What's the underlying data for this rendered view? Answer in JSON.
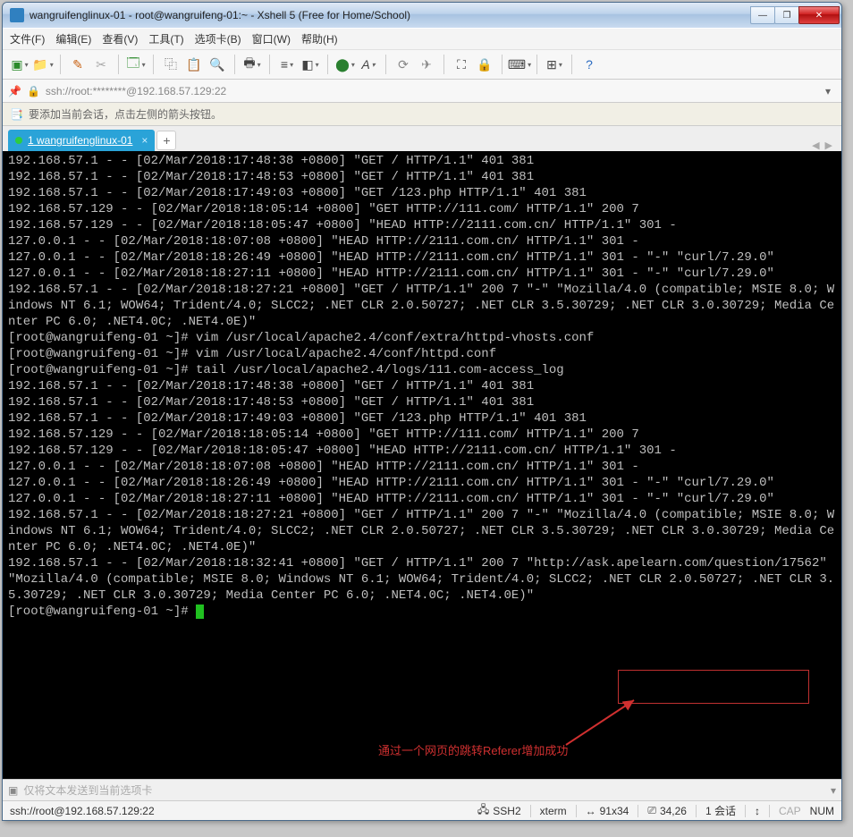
{
  "window": {
    "title": "wangruifenglinux-01 - root@wangruifeng-01:~ - Xshell 5 (Free for Home/School)"
  },
  "menu": {
    "file": "文件(F)",
    "edit": "编辑(E)",
    "view": "查看(V)",
    "tools": "工具(T)",
    "tab": "选项卡(B)",
    "window": "窗口(W)",
    "help": "帮助(H)"
  },
  "address": {
    "url": "ssh://root:********@192.168.57.129:22"
  },
  "infobar": {
    "text": "要添加当前会话，点击左侧的箭头按钮。"
  },
  "tab": {
    "label": "1 wangruifenglinux-01"
  },
  "terminal": {
    "lines": [
      "192.168.57.1 - - [02/Mar/2018:17:48:38 +0800] \"GET / HTTP/1.1\" 401 381",
      "192.168.57.1 - - [02/Mar/2018:17:48:53 +0800] \"GET / HTTP/1.1\" 401 381",
      "192.168.57.1 - - [02/Mar/2018:17:49:03 +0800] \"GET /123.php HTTP/1.1\" 401 381",
      "192.168.57.129 - - [02/Mar/2018:18:05:14 +0800] \"GET HTTP://111.com/ HTTP/1.1\" 200 7",
      "192.168.57.129 - - [02/Mar/2018:18:05:47 +0800] \"HEAD HTTP://2111.com.cn/ HTTP/1.1\" 301 -",
      "127.0.0.1 - - [02/Mar/2018:18:07:08 +0800] \"HEAD HTTP://2111.com.cn/ HTTP/1.1\" 301 -",
      "127.0.0.1 - - [02/Mar/2018:18:26:49 +0800] \"HEAD HTTP://2111.com.cn/ HTTP/1.1\" 301 - \"-\" \"curl/7.29.0\"",
      "127.0.0.1 - - [02/Mar/2018:18:27:11 +0800] \"HEAD HTTP://2111.com.cn/ HTTP/1.1\" 301 - \"-\" \"curl/7.29.0\"",
      "192.168.57.1 - - [02/Mar/2018:18:27:21 +0800] \"GET / HTTP/1.1\" 200 7 \"-\" \"Mozilla/4.0 (compatible; MSIE 8.0; Windows NT 6.1; WOW64; Trident/4.0; SLCC2; .NET CLR 2.0.50727; .NET CLR 3.5.30729; .NET CLR 3.0.30729; Media Center PC 6.0; .NET4.0C; .NET4.0E)\"",
      "[root@wangruifeng-01 ~]# vim /usr/local/apache2.4/conf/extra/httpd-vhosts.conf",
      "[root@wangruifeng-01 ~]# vim /usr/local/apache2.4/conf/httpd.conf",
      "[root@wangruifeng-01 ~]# tail /usr/local/apache2.4/logs/111.com-access_log",
      "192.168.57.1 - - [02/Mar/2018:17:48:38 +0800] \"GET / HTTP/1.1\" 401 381",
      "192.168.57.1 - - [02/Mar/2018:17:48:53 +0800] \"GET / HTTP/1.1\" 401 381",
      "192.168.57.1 - - [02/Mar/2018:17:49:03 +0800] \"GET /123.php HTTP/1.1\" 401 381",
      "192.168.57.129 - - [02/Mar/2018:18:05:14 +0800] \"GET HTTP://111.com/ HTTP/1.1\" 200 7",
      "192.168.57.129 - - [02/Mar/2018:18:05:47 +0800] \"HEAD HTTP://2111.com.cn/ HTTP/1.1\" 301 -",
      "127.0.0.1 - - [02/Mar/2018:18:07:08 +0800] \"HEAD HTTP://2111.com.cn/ HTTP/1.1\" 301 -",
      "127.0.0.1 - - [02/Mar/2018:18:26:49 +0800] \"HEAD HTTP://2111.com.cn/ HTTP/1.1\" 301 - \"-\" \"curl/7.29.0\"",
      "127.0.0.1 - - [02/Mar/2018:18:27:11 +0800] \"HEAD HTTP://2111.com.cn/ HTTP/1.1\" 301 - \"-\" \"curl/7.29.0\"",
      "192.168.57.1 - - [02/Mar/2018:18:27:21 +0800] \"GET / HTTP/1.1\" 200 7 \"-\" \"Mozilla/4.0 (compatible; MSIE 8.0; Windows NT 6.1; WOW64; Trident/4.0; SLCC2; .NET CLR 2.0.50727; .NET CLR 3.5.30729; .NET CLR 3.0.30729; Media Center PC 6.0; .NET4.0C; .NET4.0E)\"",
      "192.168.57.1 - - [02/Mar/2018:18:32:41 +0800] \"GET / HTTP/1.1\" 200 7 \"http://ask.apelearn.com/question/17562\" \"Mozilla/4.0 (compatible; MSIE 8.0; Windows NT 6.1; WOW64; Trident/4.0; SLCC2; .NET CLR 2.0.50727; .NET CLR 3.5.30729; .NET CLR 3.0.30729; Media Center PC 6.0; .NET4.0C; .NET4.0E)\""
    ],
    "prompt": "[root@wangruifeng-01 ~]# ",
    "annotation": "通过一个网页的跳转Referer增加成功",
    "highlighted_url": "http://ask.apelearn.com/question/17562"
  },
  "cmdbar": {
    "placeholder": "仅将文本发送到当前选项卡"
  },
  "status": {
    "left": "ssh://root@192.168.57.129:22",
    "ssh": "SSH2",
    "term": "xterm",
    "size": "91x34",
    "pos": "34,26",
    "sess": "1 会话",
    "cap": "CAP",
    "num": "NUM"
  }
}
